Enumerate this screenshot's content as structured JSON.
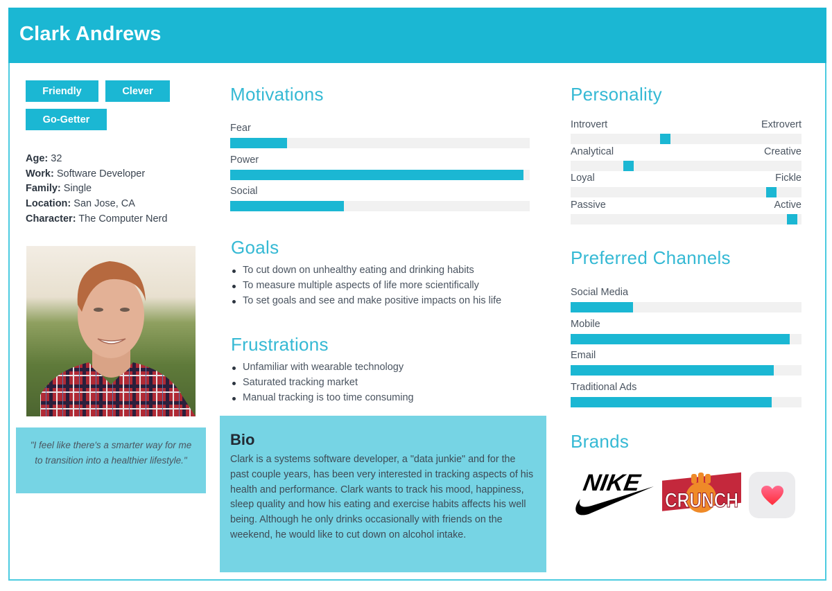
{
  "persona": {
    "name": "Clark Andrews",
    "tags": [
      "Friendly",
      "Clever",
      "Go-Getter"
    ],
    "facts": [
      {
        "label": "Age:",
        "value": "32"
      },
      {
        "label": "Work:",
        "value": "Software Developer"
      },
      {
        "label": "Family:",
        "value": "Single"
      },
      {
        "label": "Location:",
        "value": "San Jose, CA"
      },
      {
        "label": "Character:",
        "value": "The Computer Nerd"
      }
    ],
    "photo_icon": "portrait-photo",
    "quote": "\"I feel like there's a smarter way for me to transition into a healthier lifestyle.\""
  },
  "motivations": {
    "title": "Motivations",
    "items": [
      {
        "label": "Fear",
        "percent": 19
      },
      {
        "label": "Power",
        "percent": 98
      },
      {
        "label": "Social",
        "percent": 38
      }
    ]
  },
  "goals": {
    "title": "Goals",
    "items": [
      "To cut down on unhealthy eating and drinking habits",
      "To measure multiple aspects of life more scientifically",
      "To set goals and see and make positive impacts on his life"
    ]
  },
  "frustrations": {
    "title": "Frustrations",
    "items": [
      "Unfamiliar with wearable technology",
      "Saturated tracking market",
      "Manual tracking is too time consuming"
    ]
  },
  "bio": {
    "title": "Bio",
    "text": "Clark is a systems software developer, a \"data junkie\" and for the past couple years, has been very interested in tracking aspects of his health and performance. Clark wants to track his mood, happiness, sleep quality and how his eating and exercise habits affects his well being. Although he only drinks occasionally with friends on the weekend, he would like to cut down on alcohol intake."
  },
  "personality": {
    "title": "Personality",
    "items": [
      {
        "left": "Introvert",
        "right": "Extrovert",
        "position": 41
      },
      {
        "left": "Analytical",
        "right": "Creative",
        "position": 25
      },
      {
        "left": "Loyal",
        "right": "Fickle",
        "position": 87
      },
      {
        "left": "Passive",
        "right": "Active",
        "position": 96
      }
    ]
  },
  "channels": {
    "title": "Preferred Channels",
    "items": [
      {
        "label": "Social Media",
        "percent": 27
      },
      {
        "label": "Mobile",
        "percent": 95
      },
      {
        "label": "Email",
        "percent": 88
      },
      {
        "label": "Traditional Ads",
        "percent": 87
      }
    ]
  },
  "brands": {
    "title": "Brands",
    "items": [
      {
        "name": "NIKE",
        "icon": "nike-logo"
      },
      {
        "name": "CRUNCH",
        "icon": "crunch-logo"
      },
      {
        "name": "Health",
        "icon": "apple-health-heart-icon"
      }
    ]
  },
  "colors": {
    "accent": "#1bb7d3",
    "accent_light": "#76d4e4",
    "heading": "#35b9d4",
    "track": "#f1f1f1"
  }
}
